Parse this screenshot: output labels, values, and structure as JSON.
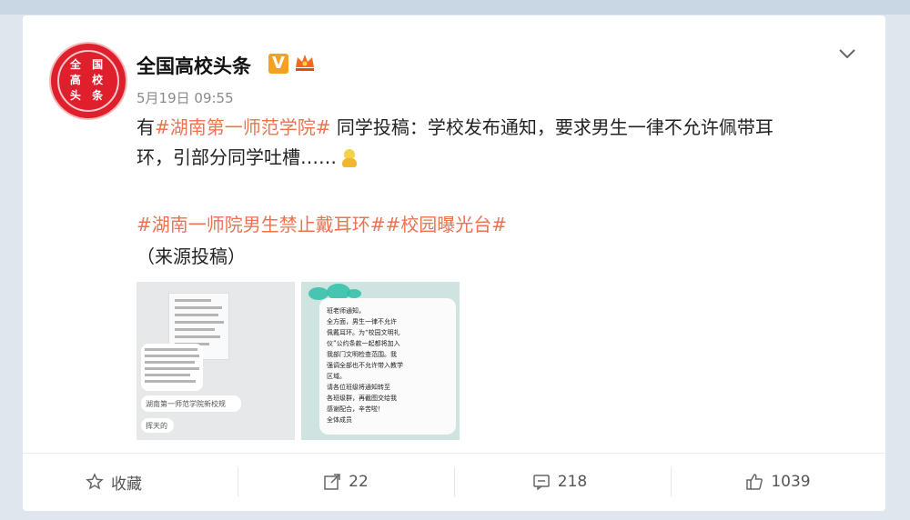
{
  "post": {
    "avatar_text": [
      "全 国",
      "高 校",
      "头 条"
    ],
    "username": "全国高校头条",
    "verified_badge": "V",
    "timestamp": "5月19日 09:55",
    "line1_prefix": "有",
    "line1_tag": "#湖南第一师范学院#",
    "line1_rest": " 同学投稿：学校发布通知，要求男生一律不允许佩带耳",
    "line2": "环，引部分同学吐槽……",
    "hashtags": "#湖南一师院男生禁止戴耳环##校园曝光台#",
    "source": "（来源投稿）",
    "image1_captions": [
      "湖南第一师范学院新校规",
      "挥天的"
    ],
    "image2_text": [
      "班老师通知，",
      "全方面，男生一律不允许",
      "佩戴耳环。为“校园文明礼",
      "仪”公约条款一起都将加入",
      "我部门文明检查范围。我",
      "强调全部也不允许带入教学",
      "区域。",
      "请各位班级将通知转至",
      "各班级群，再截图交给我",
      "感谢配合，辛苦啦！",
      "全体成员"
    ]
  },
  "actions": {
    "favorite_label": "收藏",
    "repost_count": "22",
    "comment_count": "218",
    "like_count": "1039"
  },
  "icons": [
    "star-icon",
    "share-icon",
    "comment-icon",
    "like-icon",
    "chevron-down-icon",
    "crown-badge-icon",
    "emoji-icon"
  ],
  "colors": {
    "hashtag": "#eb7350",
    "avatar_red": "#e01f2d",
    "verified": "#f3a11f"
  }
}
